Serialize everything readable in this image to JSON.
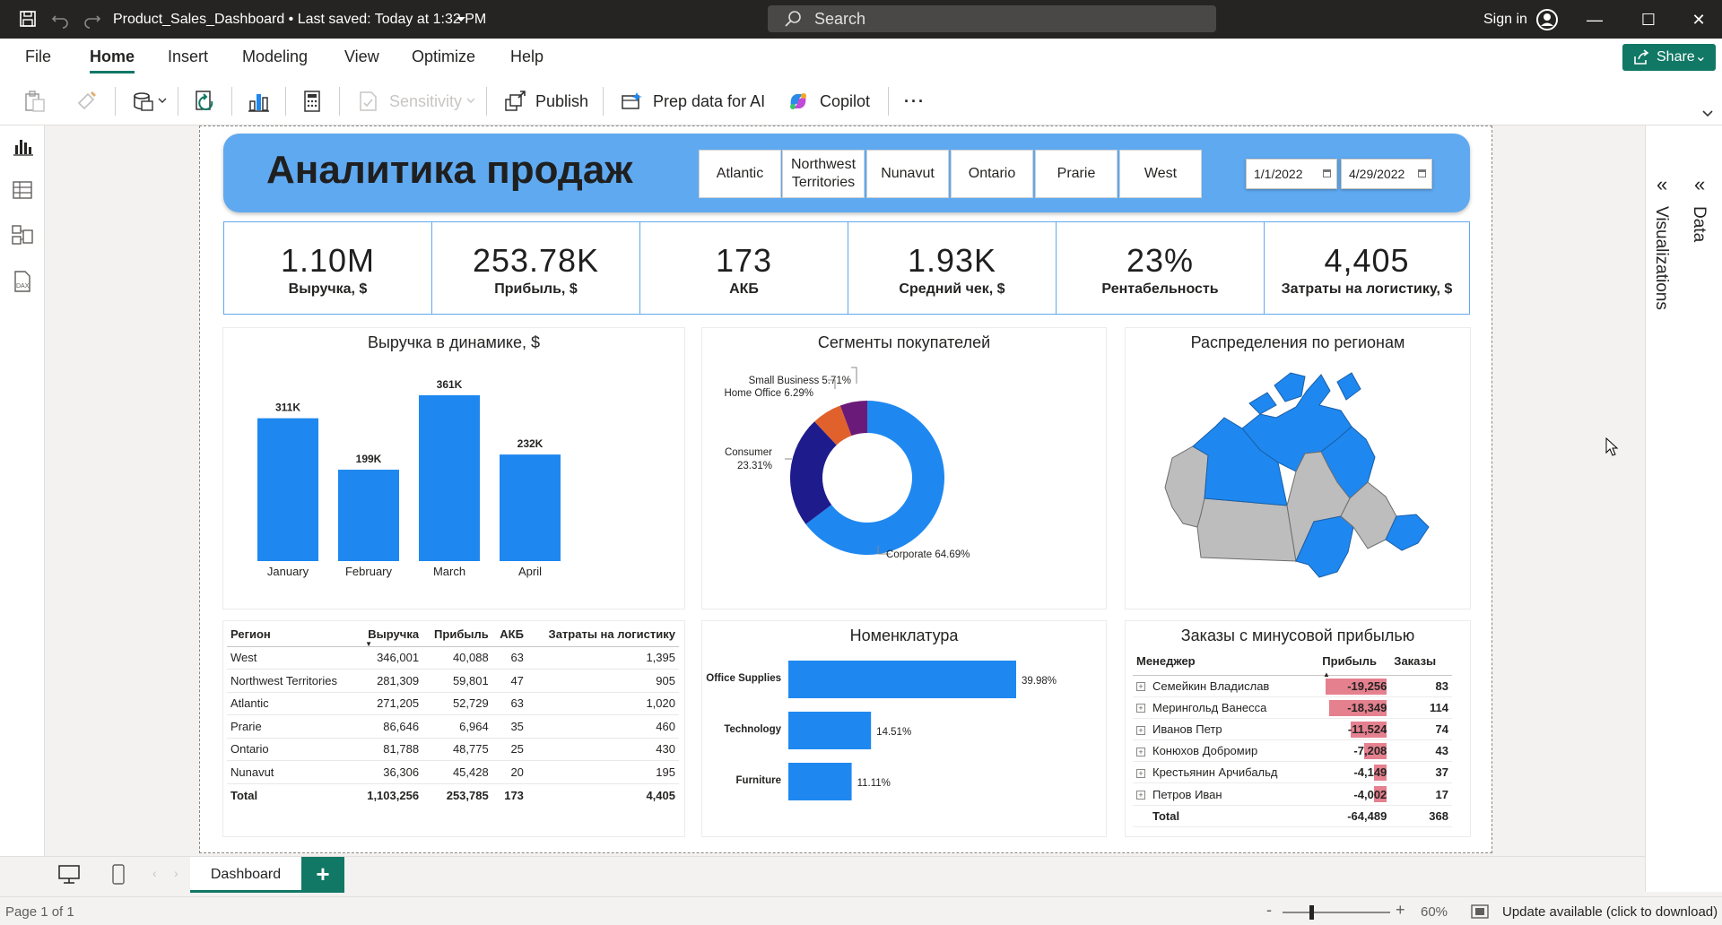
{
  "titlebar": {
    "doc_title": "Product_Sales_Dashboard • Last saved: Today at 1:32 PM",
    "search_placeholder": "Search",
    "sign_in": "Sign in"
  },
  "menu": {
    "items": [
      "File",
      "Home",
      "Insert",
      "Modeling",
      "View",
      "Optimize",
      "Help"
    ],
    "active": "Home",
    "share_label": "Share"
  },
  "ribbon": {
    "sensitivity": "Sensitivity",
    "publish": "Publish",
    "prep_data": "Prep data for AI",
    "copilot": "Copilot",
    "more": "···"
  },
  "panes": {
    "visualizations": "Visualizations",
    "data": "Data"
  },
  "report": {
    "title": "Аналитика продаж",
    "regions": [
      "Atlantic",
      "Northwest Territories",
      "Nunavut",
      "Ontario",
      "Prarie",
      "West"
    ],
    "date_from": "1/1/2022",
    "date_to": "4/29/2022",
    "kpis": [
      {
        "value": "1.10M",
        "label": "Выручка, $"
      },
      {
        "value": "253.78K",
        "label": "Прибыль, $"
      },
      {
        "value": "173",
        "label": "АКБ"
      },
      {
        "value": "1.93K",
        "label": "Средний чек, $"
      },
      {
        "value": "23%",
        "label": "Рентабельность"
      },
      {
        "value": "4,405",
        "label": "Затраты на логистику, $"
      }
    ],
    "revenue_title": "Выручка в динамике, $",
    "segments_title": "Сегменты покупателей",
    "map_title": "Распределения по регионам",
    "nomenclature_title": "Номенклатура",
    "orders_title": "Заказы с минусовой прибылью",
    "region_table": {
      "headers": [
        "Регион",
        "Выручка",
        "Прибыль",
        "АКБ",
        "Затраты на логистику"
      ],
      "rows": [
        [
          "West",
          "346,001",
          "40,088",
          "63",
          "1,395"
        ],
        [
          "Northwest Territories",
          "281,309",
          "59,801",
          "47",
          "905"
        ],
        [
          "Atlantic",
          "271,205",
          "52,729",
          "63",
          "1,020"
        ],
        [
          "Prarie",
          "86,646",
          "6,964",
          "35",
          "460"
        ],
        [
          "Ontario",
          "81,788",
          "48,775",
          "25",
          "430"
        ],
        [
          "Nunavut",
          "36,306",
          "45,428",
          "20",
          "195"
        ]
      ],
      "total": [
        "Total",
        "1,103,256",
        "253,785",
        "173",
        "4,405"
      ]
    },
    "orders_table": {
      "headers": [
        "Менеджер",
        "Прибыль",
        "Заказы"
      ],
      "rows": [
        {
          "name": "Семейкин Владислав",
          "profit": "-19,256",
          "profit_value": -19256,
          "orders": "83"
        },
        {
          "name": "Мерингольд Ванесса",
          "profit": "-18,349",
          "profit_value": -18349,
          "orders": "114"
        },
        {
          "name": "Иванов Петр",
          "profit": "-11,524",
          "profit_value": -11524,
          "orders": "74"
        },
        {
          "name": "Конюхов Добромир",
          "profit": "-7,208",
          "profit_value": -7208,
          "orders": "43"
        },
        {
          "name": "Крестьянин Арчибальд",
          "profit": "-4,149",
          "profit_value": -4149,
          "orders": "37"
        },
        {
          "name": "Петров Иван",
          "profit": "-4,002",
          "profit_value": -4002,
          "orders": "17"
        }
      ],
      "total": {
        "name": "Total",
        "profit": "-64,489",
        "orders": "368"
      },
      "bar_color": "#e5808f"
    }
  },
  "tabs": {
    "page_tab": "Dashboard",
    "add": "+"
  },
  "status": {
    "page": "Page 1 of 1",
    "zoom": "60%",
    "update": "Update available (click to download)"
  },
  "colors": {
    "accent": "#117865",
    "brand_blue": "#1e88f0",
    "header_blue": "#5fa9f0"
  },
  "chart_data": [
    {
      "type": "bar",
      "categories": [
        "January",
        "February",
        "March",
        "April"
      ],
      "values": [
        311,
        199,
        361,
        232
      ],
      "value_labels": [
        "311K",
        "199K",
        "361K",
        "232K"
      ],
      "ylim": [
        0,
        361
      ],
      "color": "#1e88f0"
    },
    {
      "type": "pie",
      "donut": true,
      "labels": [
        "Corporate",
        "Consumer",
        "Home Office",
        "Small Business"
      ],
      "values": [
        64.69,
        23.31,
        6.29,
        5.71
      ],
      "label_texts": [
        "Corporate 64.69%",
        "Consumer",
        "23.31%",
        "Home Office 6.29%",
        "Small Business 5.71%"
      ],
      "colors": [
        "#1e88f0",
        "#1e1b8c",
        "#e0612c",
        "#6a1a78"
      ]
    },
    {
      "type": "bar",
      "orientation": "horizontal",
      "categories": [
        "Office Supplies",
        "Technology",
        "Furniture"
      ],
      "values": [
        39.98,
        14.51,
        11.11
      ],
      "value_labels": [
        "39.98%",
        "14.51%",
        "11.11%"
      ],
      "color": "#1e88f0"
    }
  ]
}
